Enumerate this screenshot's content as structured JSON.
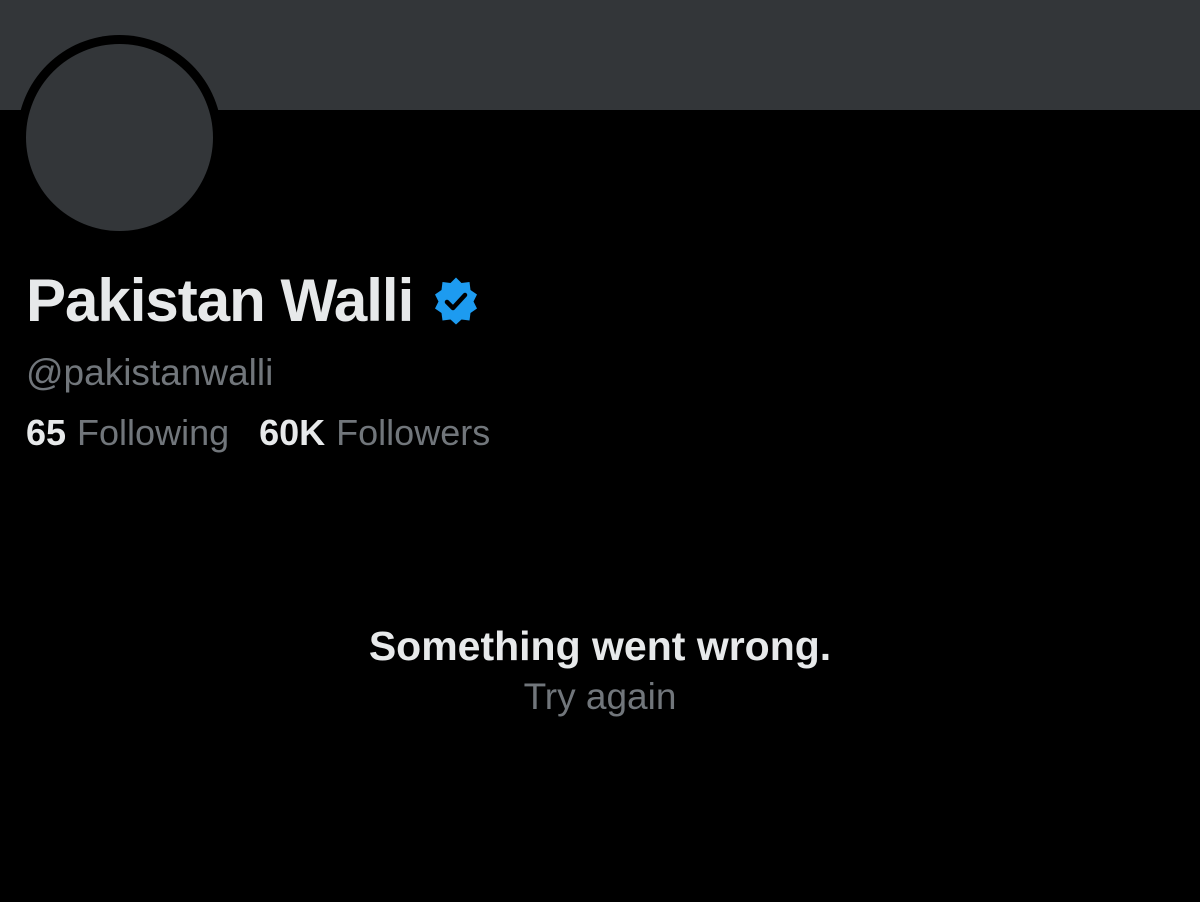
{
  "profile": {
    "display_name": "Pakistan Walli",
    "handle": "@pakistanwalli",
    "verified_icon": "verified-badge-icon",
    "following_count": "65",
    "following_label": "Following",
    "followers_count": "60K",
    "followers_label": "Followers"
  },
  "error": {
    "message": "Something went wrong.",
    "retry_label": "Try again"
  },
  "colors": {
    "background": "#000000",
    "banner": "#333639",
    "primary_text": "#e7e9ea",
    "secondary_text": "#71767b",
    "verified_blue": "#1d9bf0"
  }
}
